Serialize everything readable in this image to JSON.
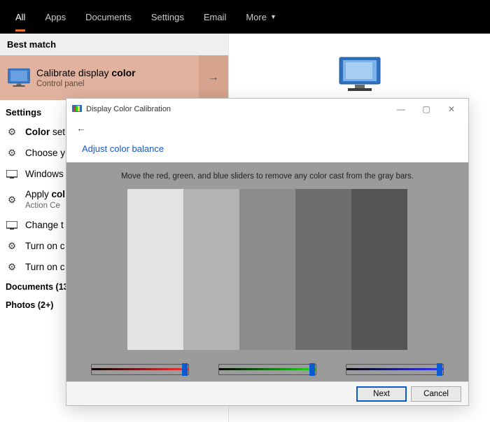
{
  "tabs": {
    "all": "All",
    "apps": "Apps",
    "documents": "Documents",
    "settings": "Settings",
    "email": "Email",
    "more": "More"
  },
  "bestmatch_label": "Best match",
  "match": {
    "title_prefix": "Calibrate display ",
    "title_bold": "color",
    "subtitle": "Control panel"
  },
  "settings_label": "Settings",
  "items": {
    "color_settings_prefix": "Color ",
    "color_settings_rest": "set",
    "choose": "Choose y",
    "windows": "Windows",
    "apply_prefix": "Apply ",
    "apply_bold": "col",
    "apply_sub": "Action Ce",
    "change": "Change t",
    "turnon1": "Turn on c",
    "turnon2": "Turn on c"
  },
  "docs_label": "Documents (13",
  "photos_label": "Photos (2+)",
  "dialog": {
    "title": "Display Color Calibration",
    "heading": "Adjust color balance",
    "instruction": "Move the red, green, and blue sliders to remove any color cast from the gray bars.",
    "next": "Next",
    "cancel": "Cancel"
  },
  "bars": [
    "#e3e3e3",
    "#b3b3b3",
    "#8d8d8d",
    "#6e6e6e",
    "#555555"
  ]
}
